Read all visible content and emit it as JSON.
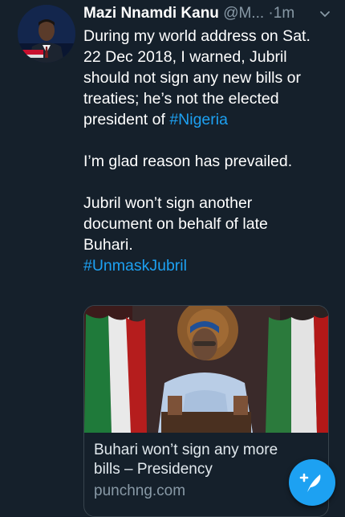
{
  "tweet": {
    "author_name": "Mazi Nnamdi Kanu",
    "author_handle": "@M...",
    "separator": "·",
    "time": "1m",
    "body": {
      "para1_prefix": "During my world address on  Sat.\n22 Dec 2018, I warned, Jubril\nshould not sign any new bills or\ntreaties; he’s not the elected\npresident of ",
      "para1_hashtag": "#Nigeria",
      "para2": "I’m glad reason has prevailed.",
      "para3": "Jubril won’t sign another\ndocument on behalf of late\nBuhari.",
      "hashtag2": "#UnmaskJubril"
    },
    "link_card": {
      "title": "Buhari won’t sign any more\nbills – Presidency",
      "domain": "punchng.com"
    }
  },
  "colors": {
    "background": "#15202b",
    "accent": "#1da1f2",
    "secondary_text": "#8899a6"
  },
  "icons": {
    "menu": "chevron-down-icon",
    "compose": "compose-tweet-icon"
  }
}
